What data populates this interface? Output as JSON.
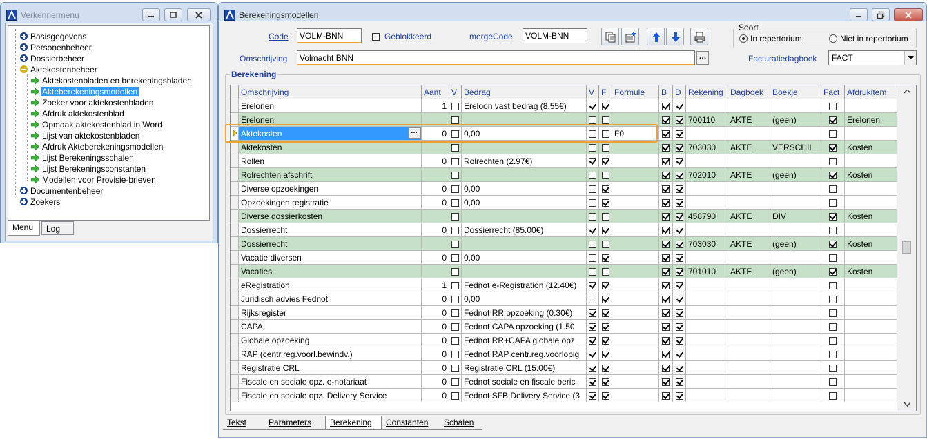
{
  "verkenner": {
    "title": "Verkennermenu",
    "tree": [
      {
        "label": "Basisgegevens",
        "icon": "plus-icon",
        "level": 0
      },
      {
        "label": "Personenbeheer",
        "icon": "plus-icon",
        "level": 0
      },
      {
        "label": "Dossierbeheer",
        "icon": "plus-icon",
        "level": 0
      },
      {
        "label": "Aktekostenbeheer",
        "icon": "minus-icon",
        "level": 0
      },
      {
        "label": "Aktekostenbladen en berekeningsbladen",
        "icon": "arrow-icon",
        "level": 1
      },
      {
        "label": "Akteberekeningsmodellen",
        "icon": "arrow-icon",
        "level": 1,
        "selected": true
      },
      {
        "label": "Zoeker voor aktekostenbladen",
        "icon": "arrow-icon",
        "level": 1
      },
      {
        "label": "Afdruk aktekostenblad",
        "icon": "arrow-icon",
        "level": 1
      },
      {
        "label": "Opmaak aktekostenblad in Word",
        "icon": "arrow-icon",
        "level": 1
      },
      {
        "label": "Lijst van aktekostenbladen",
        "icon": "arrow-icon",
        "level": 1
      },
      {
        "label": "Afdruk Akteberekeningsmodellen",
        "icon": "arrow-icon",
        "level": 1
      },
      {
        "label": "Lijst Berekeningsschalen",
        "icon": "arrow-icon",
        "level": 1
      },
      {
        "label": "Lijst Berekeningsconstanten",
        "icon": "arrow-icon",
        "level": 1
      },
      {
        "label": "Modellen voor Provisie-brieven",
        "icon": "arrow-icon",
        "level": 1
      },
      {
        "label": "Documentenbeheer",
        "icon": "plus-icon",
        "level": 0
      },
      {
        "label": "Zoekers",
        "icon": "plus-icon",
        "level": 0
      }
    ],
    "tabs": [
      "Menu",
      "Log"
    ],
    "active_tab": "Menu"
  },
  "main": {
    "title": "Berekeningsmodellen",
    "code_label": "Code",
    "code_value": "VOLM-BNN",
    "geblokkeerd_label": "Geblokkeerd",
    "geblokkeerd_checked": false,
    "mergecode_label": "mergeCode",
    "mergecode_value": "VOLM-BNN",
    "omschrijving_label": "Omschrijving",
    "omschrijving_value": "Volmacht BNN",
    "soort_title": "Soort",
    "soort_options": [
      "In repertorium",
      "Niet in repertorium"
    ],
    "soort_selected": "In repertorium",
    "facturatiedagboek_label": "Facturatiedagboek",
    "facturatiedagboek_value": "FACT",
    "berekening_title": "Berekening",
    "toolbar_icons": [
      "copy-icon",
      "new-record-icon",
      "move-up-icon",
      "move-down-icon",
      "print-icon"
    ],
    "colors": {
      "green_row": "#c7e1c8",
      "selection": "#3399ff",
      "highlight": "#f0a030",
      "label_blue": "#1f3fa0"
    }
  },
  "grid": {
    "headers": [
      "Omschrijving",
      "Aant",
      "V",
      "Bedrag",
      "V",
      "F",
      "Formule",
      "B",
      "D",
      "Rekening",
      "Dagboek",
      "Boekje",
      "Fact",
      "Afdrukitem"
    ],
    "rows": [
      {
        "omschr": "Erelonen",
        "aant": "1",
        "v1": false,
        "bedrag": "Ereloon vast bedrag (8.55€)",
        "v2": true,
        "f": true,
        "formule": "",
        "b": true,
        "d": true,
        "rek": "",
        "dag": "",
        "boek": "",
        "fact": false,
        "afdruk": "",
        "green": false
      },
      {
        "omschr": "Erelonen",
        "aant": "",
        "v1": false,
        "bedrag": "",
        "v2": false,
        "f": false,
        "formule": "",
        "b": true,
        "d": true,
        "rek": "700110",
        "dag": "AKTE",
        "boek": "(geen)",
        "fact": true,
        "afdruk": "Erelonen",
        "green": true
      },
      {
        "omschr": "Aktekosten",
        "aant": "0",
        "v1": false,
        "bedrag": "0,00",
        "v2": false,
        "f": false,
        "formule": "F0",
        "b": true,
        "d": true,
        "rek": "",
        "dag": "",
        "boek": "",
        "fact": false,
        "afdruk": "",
        "green": false,
        "selected": true
      },
      {
        "omschr": "Aktekosten",
        "aant": "",
        "v1": false,
        "bedrag": "",
        "v2": false,
        "f": false,
        "formule": "",
        "b": true,
        "d": true,
        "rek": "703030",
        "dag": "AKTE",
        "boek": "VERSCHIL",
        "fact": true,
        "afdruk": "Kosten",
        "green": true
      },
      {
        "omschr": "Rollen",
        "aant": "0",
        "v1": false,
        "bedrag": "Rolrechten (2.97€)",
        "v2": true,
        "f": true,
        "formule": "",
        "b": true,
        "d": true,
        "rek": "",
        "dag": "",
        "boek": "",
        "fact": false,
        "afdruk": "",
        "green": false
      },
      {
        "omschr": "Rolrechten afschrift",
        "aant": "",
        "v1": false,
        "bedrag": "",
        "v2": false,
        "f": false,
        "formule": "",
        "b": true,
        "d": true,
        "rek": "702010",
        "dag": "AKTE",
        "boek": "(geen)",
        "fact": true,
        "afdruk": "Kosten",
        "green": true
      },
      {
        "omschr": "Diverse opzoekingen",
        "aant": "0",
        "v1": false,
        "bedrag": "0,00",
        "v2": false,
        "f": true,
        "formule": "",
        "b": true,
        "d": true,
        "rek": "",
        "dag": "",
        "boek": "",
        "fact": false,
        "afdruk": "",
        "green": false
      },
      {
        "omschr": "Opzoekingen registratie",
        "aant": "0",
        "v1": false,
        "bedrag": "0,00",
        "v2": false,
        "f": true,
        "formule": "",
        "b": true,
        "d": true,
        "rek": "",
        "dag": "",
        "boek": "",
        "fact": false,
        "afdruk": "",
        "green": false
      },
      {
        "omschr": "Diverse dossierkosten",
        "aant": "",
        "v1": false,
        "bedrag": "",
        "v2": false,
        "f": false,
        "formule": "",
        "b": true,
        "d": true,
        "rek": "458790",
        "dag": "AKTE",
        "boek": "DIV",
        "fact": true,
        "afdruk": "Kosten",
        "green": true
      },
      {
        "omschr": "Dossierrecht",
        "aant": "0",
        "v1": false,
        "bedrag": "Dossierrecht (85.00€)",
        "v2": true,
        "f": true,
        "formule": "",
        "b": true,
        "d": true,
        "rek": "",
        "dag": "",
        "boek": "",
        "fact": false,
        "afdruk": "",
        "green": false
      },
      {
        "omschr": "Dossierrecht",
        "aant": "",
        "v1": false,
        "bedrag": "",
        "v2": false,
        "f": false,
        "formule": "",
        "b": true,
        "d": true,
        "rek": "703030",
        "dag": "AKTE",
        "boek": "(geen)",
        "fact": true,
        "afdruk": "Kosten",
        "green": true
      },
      {
        "omschr": "Vacatie diversen",
        "aant": "0",
        "v1": false,
        "bedrag": "0,00",
        "v2": false,
        "f": true,
        "formule": "",
        "b": true,
        "d": true,
        "rek": "",
        "dag": "",
        "boek": "",
        "fact": false,
        "afdruk": "",
        "green": false
      },
      {
        "omschr": "Vacaties",
        "aant": "",
        "v1": false,
        "bedrag": "",
        "v2": false,
        "f": false,
        "formule": "",
        "b": true,
        "d": true,
        "rek": "701010",
        "dag": "AKTE",
        "boek": "(geen)",
        "fact": true,
        "afdruk": "Kosten",
        "green": true
      },
      {
        "omschr": "eRegistration",
        "aant": "1",
        "v1": false,
        "bedrag": "Fednot e-Registration (12.40€)",
        "v2": true,
        "f": true,
        "formule": "",
        "b": true,
        "d": true,
        "rek": "",
        "dag": "",
        "boek": "",
        "fact": false,
        "afdruk": "",
        "green": false
      },
      {
        "omschr": "Juridisch advies Fednot",
        "aant": "0",
        "v1": false,
        "bedrag": "0,00",
        "v2": false,
        "f": true,
        "formule": "",
        "b": true,
        "d": true,
        "rek": "",
        "dag": "",
        "boek": "",
        "fact": false,
        "afdruk": "",
        "green": false
      },
      {
        "omschr": "Rijksregister",
        "aant": "0",
        "v1": false,
        "bedrag": "Fednot RR opzoeking (0.30€)",
        "v2": true,
        "f": true,
        "formule": "",
        "b": true,
        "d": true,
        "rek": "",
        "dag": "",
        "boek": "",
        "fact": false,
        "afdruk": "",
        "green": false
      },
      {
        "omschr": "CAPA",
        "aant": "0",
        "v1": false,
        "bedrag": "Fednot CAPA opzoeking (1.50",
        "v2": true,
        "f": true,
        "formule": "",
        "b": true,
        "d": true,
        "rek": "",
        "dag": "",
        "boek": "",
        "fact": false,
        "afdruk": "",
        "green": false
      },
      {
        "omschr": "Globale opzoeking",
        "aant": "0",
        "v1": false,
        "bedrag": "Fednot RR+CAPA globale opz",
        "v2": true,
        "f": true,
        "formule": "",
        "b": true,
        "d": true,
        "rek": "",
        "dag": "",
        "boek": "",
        "fact": false,
        "afdruk": "",
        "green": false
      },
      {
        "omschr": "RAP (centr.reg.voorl.bewindv.)",
        "aant": "0",
        "v1": false,
        "bedrag": "Fednot RAP centr.reg.voorlopig",
        "v2": true,
        "f": true,
        "formule": "",
        "b": true,
        "d": true,
        "rek": "",
        "dag": "",
        "boek": "",
        "fact": false,
        "afdruk": "",
        "green": false
      },
      {
        "omschr": "Registratie CRL",
        "aant": "0",
        "v1": false,
        "bedrag": "Registratie CRL (15.00€)",
        "v2": true,
        "f": true,
        "formule": "",
        "b": true,
        "d": true,
        "rek": "",
        "dag": "",
        "boek": "",
        "fact": false,
        "afdruk": "",
        "green": false
      },
      {
        "omschr": "Fiscale en sociale opz. e-notariaat",
        "aant": "0",
        "v1": false,
        "bedrag": "Fednot sociale en fiscale beric",
        "v2": true,
        "f": true,
        "formule": "",
        "b": true,
        "d": true,
        "rek": "",
        "dag": "",
        "boek": "",
        "fact": false,
        "afdruk": "",
        "green": false
      },
      {
        "omschr": "Fiscale en sociale opz. Delivery Service",
        "aant": "0",
        "v1": false,
        "bedrag": "Fednot SFB Delivery Service (3",
        "v2": true,
        "f": true,
        "formule": "",
        "b": true,
        "d": true,
        "rek": "",
        "dag": "",
        "boek": "",
        "fact": false,
        "afdruk": "",
        "green": false
      }
    ]
  },
  "bottom_tabs": [
    "Tekst",
    "Parameters",
    "Berekening",
    "Constanten",
    "Schalen"
  ],
  "active_bottom_tab": "Berekening"
}
